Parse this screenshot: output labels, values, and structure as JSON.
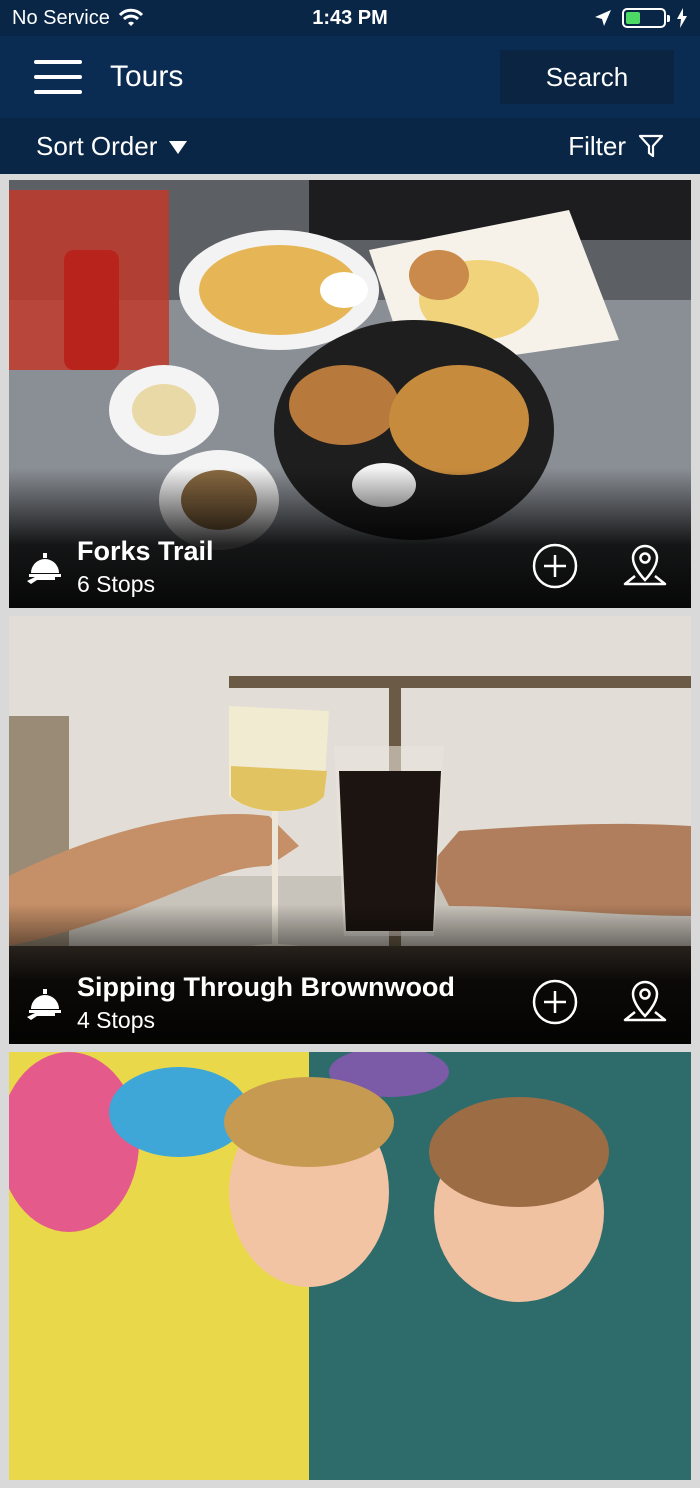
{
  "status": {
    "carrier": "No Service",
    "time": "1:43 PM"
  },
  "header": {
    "title": "Tours",
    "search_label": "Search"
  },
  "sort_bar": {
    "sort_label": "Sort Order",
    "filter_label": "Filter"
  },
  "tours": [
    {
      "title": "Forks Trail",
      "stops": "6 Stops"
    },
    {
      "title": "Sipping Through Brownwood",
      "stops": "4 Stops"
    }
  ],
  "colors": {
    "header_bg": "#0a2b52",
    "status_bg": "#0a2647",
    "battery": "#4cd964"
  },
  "icons": [
    "wifi-icon",
    "location-arrow-icon",
    "charging-icon",
    "menu-icon",
    "filter-icon",
    "service-bell-icon",
    "add-circle-icon",
    "map-pin-icon"
  ]
}
